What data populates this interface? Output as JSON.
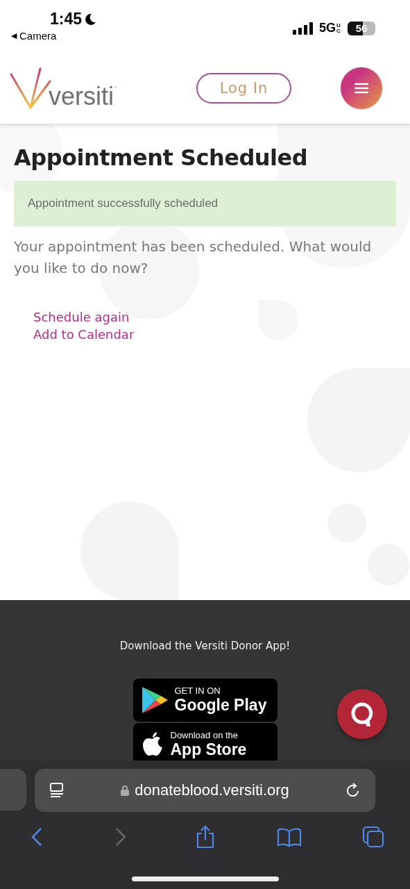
{
  "status_bar": {
    "time": "1:45",
    "back_label": "Camera",
    "network": "5G",
    "network_sub": "UC",
    "battery": "56",
    "back_arrow": "◀"
  },
  "header": {
    "logo_text": "versiti",
    "logo_mark": "™",
    "login_button": "Log In"
  },
  "main": {
    "title": "Appointment Scheduled",
    "alert": "Appointment successfully scheduled",
    "message": "Your appointment has been scheduled. What would you like to do now?",
    "links": [
      {
        "label": "Schedule again"
      },
      {
        "label": "Add to Calendar"
      }
    ]
  },
  "footer": {
    "heading": "Download the Versiti Donor App!",
    "stores": [
      {
        "kind": "google",
        "small": "GET IN ON",
        "big": "Google Play"
      },
      {
        "kind": "apple",
        "small": "Download on the",
        "big": "App Store"
      }
    ]
  },
  "browser": {
    "address": "donateblood.versiti.org",
    "back_disabled": false,
    "forward_disabled": true
  }
}
